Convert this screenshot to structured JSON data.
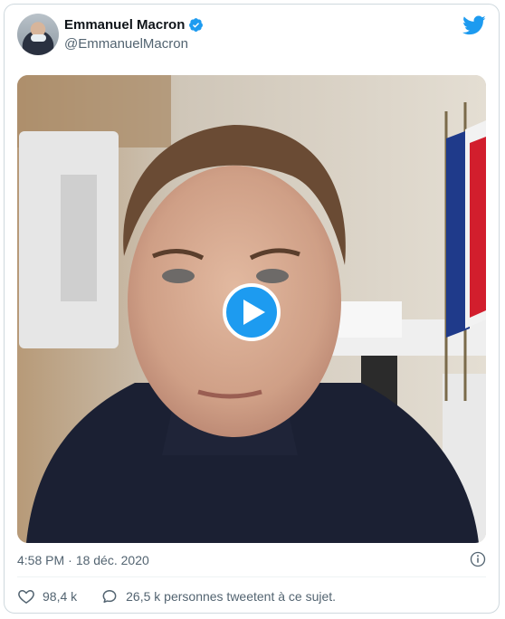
{
  "author": {
    "display_name": "Emmanuel Macron",
    "handle": "@EmmanuelMacron",
    "verified": true
  },
  "tweet": {
    "time": "4:58 PM",
    "separator": "·",
    "date": "18 déc. 2020",
    "media_type": "video"
  },
  "actions": {
    "likes": "98,4 k",
    "talking": "26,5 k personnes tweetent à ce sujet."
  },
  "colors": {
    "accent": "#1d9bf0",
    "muted_text": "#536471",
    "border": "#cfd9de"
  },
  "icons": [
    "twitter-bird-icon",
    "verified-badge-icon",
    "play-icon",
    "info-icon",
    "heart-icon",
    "reply-icon"
  ]
}
